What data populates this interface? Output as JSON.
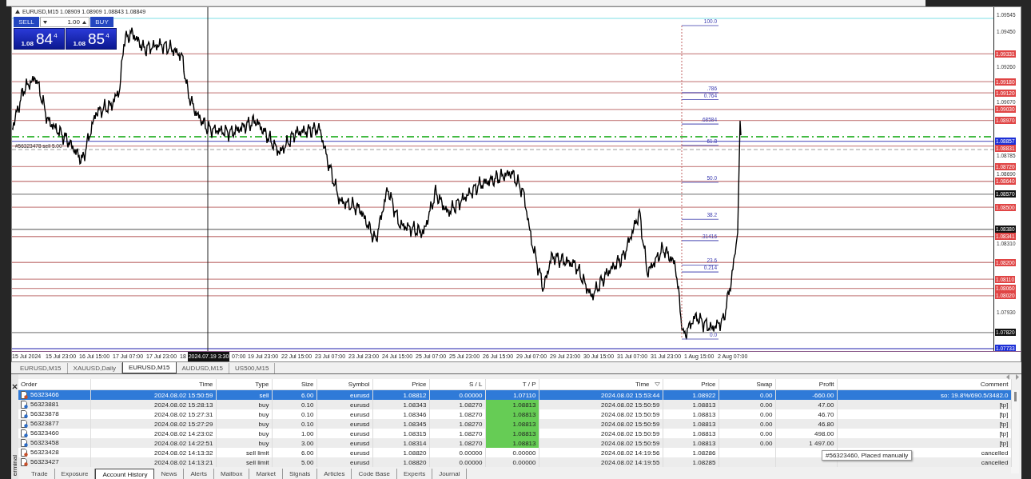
{
  "chart": {
    "header": "EURUSD,M15 1.08909 1.08909 1.08843 1.08849",
    "trade_panel": {
      "sell_label": "SELL",
      "buy_label": "BUY",
      "lot": "1.00",
      "sell_price": {
        "base": "1.08",
        "pips": "84",
        "point": "4"
      },
      "buy_price": {
        "base": "1.08",
        "pips": "85",
        "point": "4"
      }
    },
    "order_labels": [
      "#56323478 sell 5.00"
    ],
    "fibonacci": [
      "100.0",
      ".786",
      "0.764",
      ".68584",
      "61.8",
      "50.0",
      "38.2",
      ".31416",
      "23.6",
      "0.214",
      "0.0"
    ],
    "price_axis": [
      {
        "label": "1.09545",
        "kind": "tick"
      },
      {
        "label": "1.09450",
        "kind": "tick"
      },
      {
        "label": "1.09331",
        "kind": "level"
      },
      {
        "label": "1.09260",
        "kind": "tick"
      },
      {
        "label": "1.09180",
        "kind": "level"
      },
      {
        "label": "1.09120",
        "kind": "level"
      },
      {
        "label": "1.09070",
        "kind": "tick"
      },
      {
        "label": "1.09030",
        "kind": "level"
      },
      {
        "label": "1.08970",
        "kind": "level"
      },
      {
        "label": "1.08857",
        "kind": "bid"
      },
      {
        "label": "1.08831",
        "kind": "level"
      },
      {
        "label": "1.08785",
        "kind": "tick"
      },
      {
        "label": "1.08720",
        "kind": "level"
      },
      {
        "label": "1.08690",
        "kind": "tick"
      },
      {
        "label": "1.08640",
        "kind": "level"
      },
      {
        "label": "1.08570",
        "kind": "marker"
      },
      {
        "label": "1.08500",
        "kind": "level"
      },
      {
        "label": "1.08380",
        "kind": "marker"
      },
      {
        "label": "1.08341",
        "kind": "level"
      },
      {
        "label": "1.08310",
        "kind": "tick"
      },
      {
        "label": "1.08200",
        "kind": "level"
      },
      {
        "label": "1.08110",
        "kind": "level"
      },
      {
        "label": "1.08060",
        "kind": "level"
      },
      {
        "label": "1.08020",
        "kind": "level"
      },
      {
        "label": "1.07930",
        "kind": "tick"
      },
      {
        "label": "1.07820",
        "kind": "marker"
      },
      {
        "label": "1.07733",
        "kind": "bid"
      }
    ],
    "time_axis": [
      {
        "label": "15 Jul 2024",
        "kind": "tick"
      },
      {
        "label": "15 Jul 23:00",
        "kind": "tick"
      },
      {
        "label": "16 Jul 15:00",
        "kind": "tick"
      },
      {
        "label": "17 Jul 07:00",
        "kind": "tick"
      },
      {
        "label": "17 Jul 23:00",
        "kind": "tick"
      },
      {
        "label": "18",
        "kind": "tick"
      },
      {
        "label": "2024.07.19 3:30",
        "kind": "cursor"
      },
      {
        "label": "07:00",
        "kind": "partial"
      },
      {
        "label": "19 Jul 23:00",
        "kind": "tick"
      },
      {
        "label": "22 Jul 15:00",
        "kind": "tick"
      },
      {
        "label": "23 Jul 07:00",
        "kind": "tick"
      },
      {
        "label": "23 Jul 23:00",
        "kind": "tick"
      },
      {
        "label": "24 Jul 15:00",
        "kind": "tick"
      },
      {
        "label": "25 Jul 07:00",
        "kind": "tick"
      },
      {
        "label": "25 Jul 23:00",
        "kind": "tick"
      },
      {
        "label": "26 Jul 15:00",
        "kind": "tick"
      },
      {
        "label": "29 Jul 07:00",
        "kind": "tick"
      },
      {
        "label": "29 Jul 23:00",
        "kind": "tick"
      },
      {
        "label": "30 Jul 15:00",
        "kind": "tick"
      },
      {
        "label": "31 Jul 07:00",
        "kind": "tick"
      },
      {
        "label": "31 Jul 23:00",
        "kind": "tick"
      },
      {
        "label": "1 Aug 15:00",
        "kind": "tick"
      },
      {
        "label": "2 Aug 07:00",
        "kind": "tick"
      }
    ]
  },
  "chart_tabs": [
    {
      "label": "EURUSD,M15",
      "selected": false
    },
    {
      "label": "XAUUSD,Daily",
      "selected": false
    },
    {
      "label": "EURUSD,M15",
      "selected": true
    },
    {
      "label": "AUDUSD,M15",
      "selected": false
    },
    {
      "label": "US500,M15",
      "selected": false
    }
  ],
  "terminal": {
    "side_label": "erminal",
    "columns": [
      {
        "label": "Order",
        "sorted": false
      },
      {
        "label": "Time",
        "sorted": false
      },
      {
        "label": "Type",
        "sorted": false
      },
      {
        "label": "Size",
        "sorted": false
      },
      {
        "label": "Symbol",
        "sorted": false
      },
      {
        "label": "Price",
        "sorted": false
      },
      {
        "label": "S / L",
        "sorted": false
      },
      {
        "label": "T / P",
        "sorted": false
      },
      {
        "label": "Time",
        "sorted": true
      },
      {
        "label": "Price",
        "sorted": false
      },
      {
        "label": "Swap",
        "sorted": false
      },
      {
        "label": "Profit",
        "sorted": false
      },
      {
        "label": "Comment",
        "sorted": false
      }
    ],
    "rows": [
      {
        "kind": "sell",
        "selected": true,
        "tp_hit": false,
        "cells": [
          "56323466",
          "2024.08.02 15:50:59",
          "sell",
          "6.00",
          "eurusd",
          "1.08812",
          "0.00000",
          "1.07110",
          "2024.08.02 15:53:44",
          "1.08922",
          "0.00",
          "-660.00",
          "so: 19.8%/690.5/3482.0"
        ]
      },
      {
        "kind": "buy",
        "selected": false,
        "tp_hit": true,
        "cells": [
          "56323881",
          "2024.08.02 15:28:13",
          "buy",
          "0.10",
          "eurusd",
          "1.08343",
          "1.08270",
          "1.08813",
          "2024.08.02 15:50:59",
          "1.08813",
          "0.00",
          "47.00",
          "[tp]"
        ]
      },
      {
        "kind": "buy",
        "selected": false,
        "tp_hit": true,
        "cells": [
          "56323878",
          "2024.08.02 15:27:31",
          "buy",
          "0.10",
          "eurusd",
          "1.08346",
          "1.08270",
          "1.08813",
          "2024.08.02 15:50:59",
          "1.08813",
          "0.00",
          "46.70",
          "[tp]"
        ]
      },
      {
        "kind": "buy",
        "selected": false,
        "tp_hit": true,
        "cells": [
          "56323877",
          "2024.08.02 15:27:29",
          "buy",
          "0.10",
          "eurusd",
          "1.08345",
          "1.08270",
          "1.08813",
          "2024.08.02 15:50:59",
          "1.08813",
          "0.00",
          "46.80",
          "[tp]"
        ]
      },
      {
        "kind": "buy",
        "selected": false,
        "tp_hit": true,
        "cells": [
          "56323460",
          "2024.08.02 14:23:02",
          "buy",
          "1.00",
          "eurusd",
          "1.08315",
          "1.08270",
          "1.08813",
          "2024.08.02 15:50:59",
          "1.08813",
          "0.00",
          "498.00",
          "[tp]"
        ]
      },
      {
        "kind": "buy",
        "selected": false,
        "tp_hit": true,
        "cells": [
          "56323458",
          "2024.08.02 14:22:51",
          "buy",
          "3.00",
          "eurusd",
          "1.08314",
          "1.08270",
          "1.08813",
          "2024.08.02 15:50:59",
          "1.08813",
          "0.00",
          "1 497.00",
          "[tp]"
        ]
      },
      {
        "kind": "sell",
        "selected": false,
        "tp_hit": false,
        "cells": [
          "56323428",
          "2024.08.02 14:13:32",
          "sell limit",
          "6.00",
          "eurusd",
          "1.08820",
          "0.00000",
          "0.00000",
          "2024.08.02 14:19:56",
          "1.08286",
          null,
          null,
          "cancelled"
        ]
      },
      {
        "kind": "sell",
        "selected": false,
        "tp_hit": false,
        "cells": [
          "56323427",
          "2024.08.02 14:13:21",
          "sell limit",
          "5.00",
          "eurusd",
          "1.08820",
          "0.00000",
          "0.00000",
          "2024.08.02 14:19:55",
          "1.08285",
          null,
          null,
          "cancelled"
        ]
      }
    ],
    "tooltip": "#56323460, Placed manually",
    "tabs": [
      {
        "label": "Trade",
        "selected": false
      },
      {
        "label": "Exposure",
        "selected": false
      },
      {
        "label": "Account History",
        "selected": true
      },
      {
        "label": "News",
        "selected": false
      },
      {
        "label": "Alerts",
        "selected": false
      },
      {
        "label": "Mailbox",
        "selected": false
      },
      {
        "label": "Market",
        "selected": false
      },
      {
        "label": "Signals",
        "selected": false
      },
      {
        "label": "Articles",
        "selected": false
      },
      {
        "label": "Code Base",
        "selected": false
      },
      {
        "label": "Experts",
        "selected": false
      },
      {
        "label": "Journal",
        "selected": false
      }
    ]
  }
}
